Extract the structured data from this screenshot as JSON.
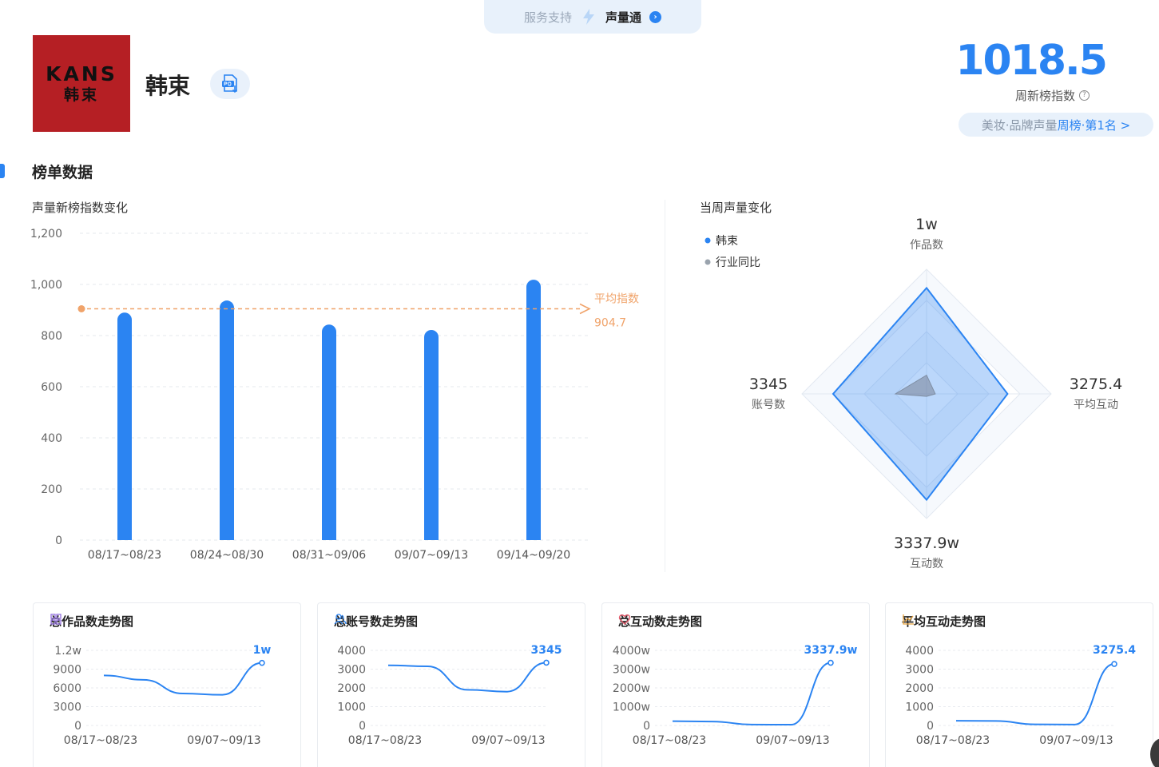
{
  "service": {
    "label": "服务支持",
    "name": "声量通"
  },
  "brand": {
    "logo_line1": "KANS",
    "logo_line2": "韩束",
    "name": "韩束"
  },
  "index": {
    "value": "1018.5",
    "label": "周新榜指数",
    "rank_category": "美妆·品牌声量",
    "rank_position": "周榜·第1名 >"
  },
  "section": {
    "title": "榜单数据"
  },
  "colors": {
    "accent": "#2b84f2",
    "average": "#f0a36a",
    "industry": "#8a9bb0"
  },
  "chart_data": [
    {
      "type": "bar",
      "title": "声量新榜指数变化",
      "categories": [
        "08/17~08/23",
        "08/24~08/30",
        "08/31~09/06",
        "09/07~09/13",
        "09/14~09/20"
      ],
      "values": [
        890,
        937,
        843,
        822,
        1018.5
      ],
      "ylim": [
        0,
        1200
      ],
      "yticks": [
        "0",
        "200",
        "400",
        "600",
        "800",
        "1,000",
        "1,200"
      ],
      "average": {
        "label": "平均指数",
        "value": 904.7,
        "value_label": "904.7"
      },
      "grid": true
    },
    {
      "type": "radar",
      "title": "当周声量变化",
      "legend": [
        "韩束",
        "行业同比"
      ],
      "legend_position": "top-left",
      "axes": [
        {
          "name": "作品数",
          "value_label": "1w"
        },
        {
          "name": "平均互动",
          "value_label": "3275.4"
        },
        {
          "name": "互动数",
          "value_label": "3337.9w"
        },
        {
          "name": "账号数",
          "value_label": "3345"
        }
      ],
      "series": [
        {
          "name": "韩束",
          "values": [
            0.85,
            0.65,
            0.85,
            0.75
          ]
        },
        {
          "name": "行业同比",
          "values": [
            0.15,
            0.07,
            0.02,
            0.25
          ]
        }
      ]
    },
    {
      "type": "line",
      "title": "总作品数走势图",
      "x": [
        "08/17~08/23",
        "08/24~08/30",
        "08/31~09/06",
        "09/07~09/13",
        "09/14~09/20"
      ],
      "xtick_labels": [
        "08/17~08/23",
        "09/07~09/13"
      ],
      "values": [
        8000,
        7300,
        5100,
        4900,
        10000
      ],
      "yticks": [
        "0",
        "3000",
        "6000",
        "9000",
        "1.2w"
      ],
      "ylim": [
        0,
        12000
      ],
      "last_label": "1w"
    },
    {
      "type": "line",
      "title": "总账号数走势图",
      "x": [
        "08/17~08/23",
        "08/24~08/30",
        "08/31~09/06",
        "09/07~09/13",
        "09/14~09/20"
      ],
      "xtick_labels": [
        "08/17~08/23",
        "09/07~09/13"
      ],
      "values": [
        3200,
        3150,
        1900,
        1800,
        3345
      ],
      "yticks": [
        "0",
        "1000",
        "2000",
        "3000",
        "4000"
      ],
      "ylim": [
        0,
        4000
      ],
      "last_label": "3345"
    },
    {
      "type": "line",
      "title": "总互动数走势图",
      "x": [
        "08/17~08/23",
        "08/24~08/30",
        "08/31~09/06",
        "09/07~09/13",
        "09/14~09/20"
      ],
      "xtick_labels": [
        "08/17~08/23",
        "09/07~09/13"
      ],
      "values": [
        230,
        210,
        50,
        40,
        3337.9
      ],
      "yticks": [
        "0",
        "1000w",
        "2000w",
        "3000w",
        "4000w"
      ],
      "ylim": [
        0,
        4000
      ],
      "last_label": "3337.9w"
    },
    {
      "type": "line",
      "title": "平均互动走势图",
      "x": [
        "08/17~08/23",
        "08/24~08/30",
        "08/31~09/06",
        "09/07~09/13",
        "09/14~09/20"
      ],
      "xtick_labels": [
        "08/17~08/23",
        "09/07~09/13"
      ],
      "values": [
        250,
        240,
        60,
        50,
        3275.4
      ],
      "yticks": [
        "0",
        "1000",
        "2000",
        "3000",
        "4000"
      ],
      "ylim": [
        0,
        4000
      ],
      "last_label": "3275.4"
    }
  ]
}
